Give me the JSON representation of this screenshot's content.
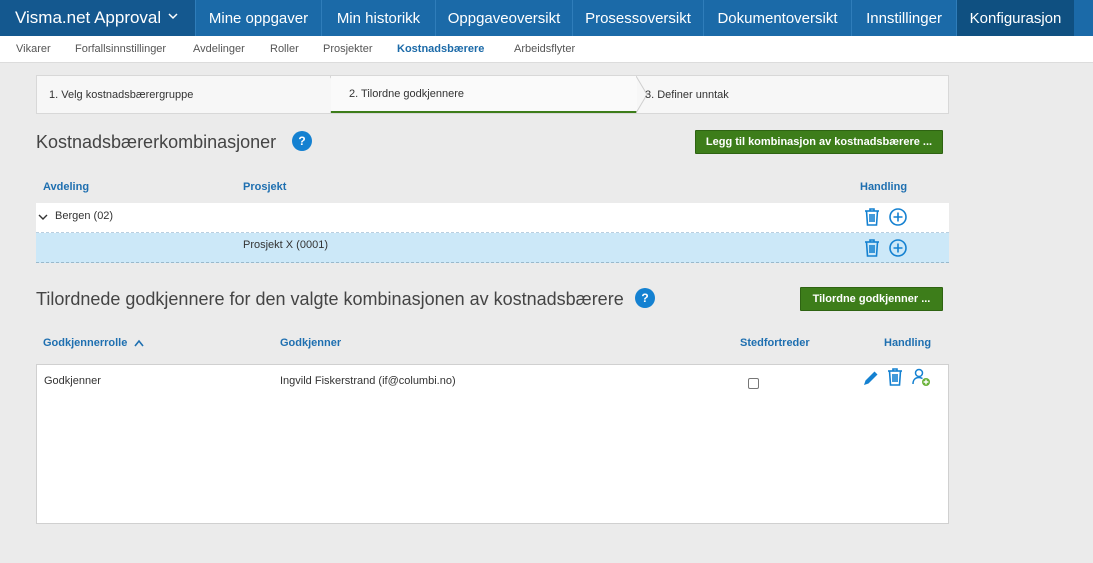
{
  "app": {
    "name": "Visma.net Approval"
  },
  "nav": {
    "items": [
      {
        "label": "Mine oppgaver"
      },
      {
        "label": "Min historikk"
      },
      {
        "label": "Oppgaveoversikt"
      },
      {
        "label": "Prosessoversikt"
      },
      {
        "label": "Dokumentoversikt"
      },
      {
        "label": "Innstillinger"
      },
      {
        "label": "Konfigurasjon"
      }
    ]
  },
  "subnav": {
    "items": [
      {
        "label": "Vikarer"
      },
      {
        "label": "Forfallsinnstillinger"
      },
      {
        "label": "Avdelinger"
      },
      {
        "label": "Roller"
      },
      {
        "label": "Prosjekter"
      },
      {
        "label": "Kostnadsbærere"
      },
      {
        "label": "Arbeidsflyter"
      }
    ]
  },
  "wizard": {
    "steps": [
      {
        "label": "1. Velg kostnadsbærergruppe"
      },
      {
        "label": "2. Tilordne godkjennere"
      },
      {
        "label": "3. Definer unntak"
      }
    ],
    "active_step": 2
  },
  "combinations": {
    "title": "Kostnadsbærerkombinasjoner",
    "help": "?",
    "add_button": "Legg til kombinasjon av kostnadsbærere ...",
    "columns": {
      "department": "Avdeling",
      "project": "Prosjekt",
      "action": "Handling"
    },
    "rows": [
      {
        "department": "Bergen (02)",
        "project": "",
        "expanded": true
      },
      {
        "department": "",
        "project": "Prosjekt X (0001)",
        "selected": true
      }
    ]
  },
  "approvers": {
    "title": "Tilordnede godkjennere for den valgte kombinasjonen av kostnadsbærere",
    "help": "?",
    "assign_button": "Tilordne godkjenner ...",
    "columns": {
      "role": "Godkjennerrolle",
      "approver": "Godkjenner",
      "substitute": "Stedfortreder",
      "action": "Handling"
    },
    "rows": [
      {
        "role": "Godkjenner",
        "approver": "Ingvild Fiskerstrand (if@columbi.no)",
        "substitute": false
      }
    ]
  },
  "colors": {
    "brand": "#14588f",
    "nav": "#1b6aa8",
    "accent_green": "#3d7d1a",
    "icon_blue": "#1481d1",
    "selected_row": "#cce8f8"
  }
}
